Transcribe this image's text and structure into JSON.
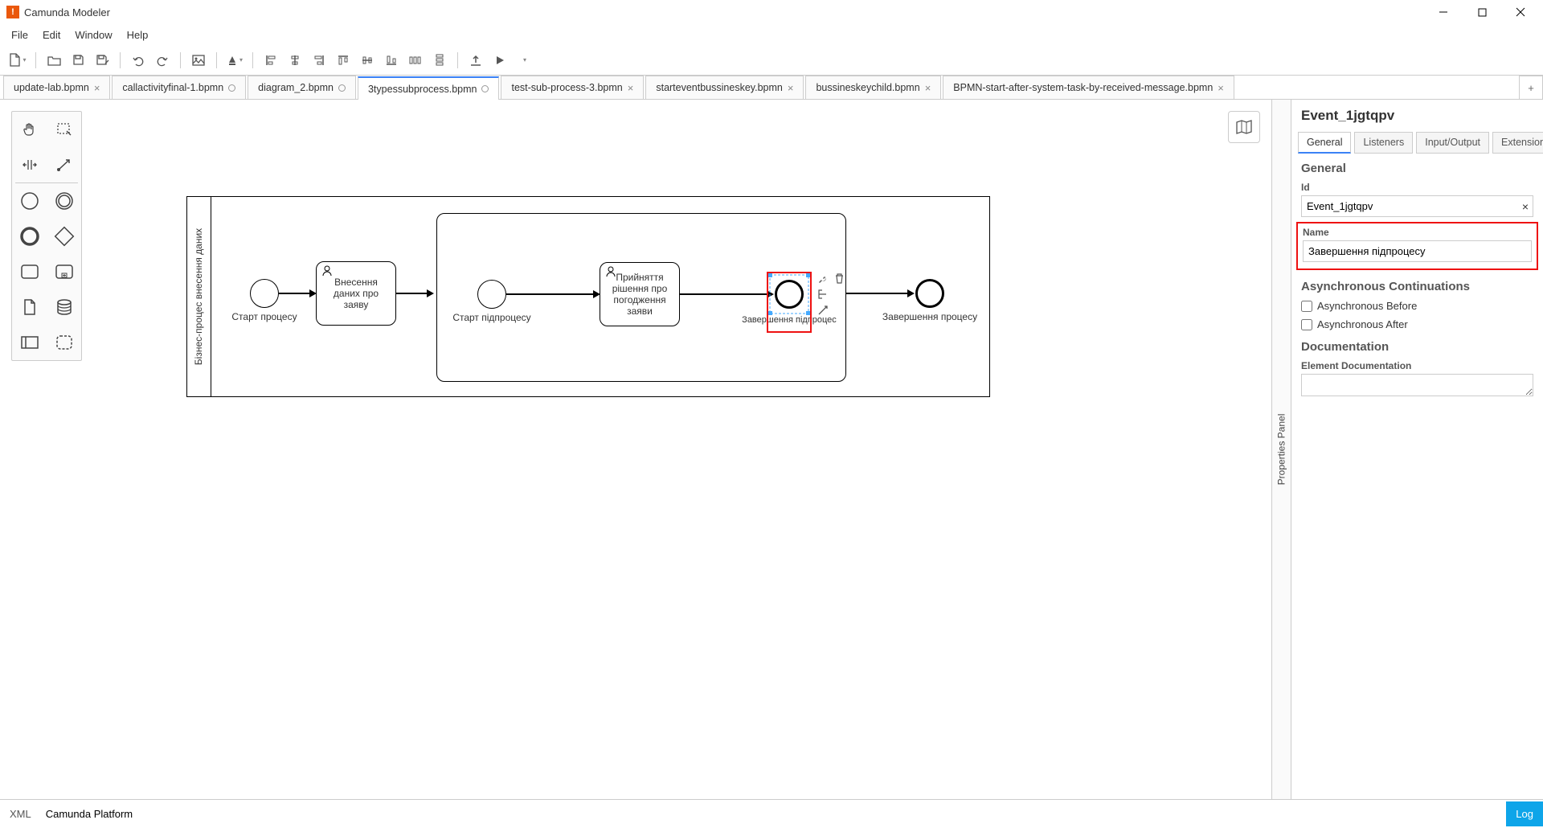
{
  "app_title": "Camunda Modeler",
  "menus": [
    "File",
    "Edit",
    "Window",
    "Help"
  ],
  "tabs": [
    {
      "label": "update-lab.bpmn",
      "icon": "x"
    },
    {
      "label": "callactivityfinal-1.bpmn",
      "icon": "dot"
    },
    {
      "label": "diagram_2.bpmn",
      "icon": "dot"
    },
    {
      "label": "3typessubprocess.bpmn",
      "icon": "dot",
      "active": true
    },
    {
      "label": "test-sub-process-3.bpmn",
      "icon": "x"
    },
    {
      "label": "starteventbussineskey.bpmn",
      "icon": "x"
    },
    {
      "label": "bussineskeychild.bpmn",
      "icon": "x"
    },
    {
      "label": "BPMN-start-after-system-task-by-received-message.bpmn",
      "icon": "x"
    }
  ],
  "diagram": {
    "lane_title": "Бізнес-процес внесення даних",
    "start1": "Старт процесу",
    "task1": "Внесення даних про заяву",
    "start2": "Старт підпроцесу",
    "task2": "Прийняття рішення про погодження заяви",
    "end2": "Завершення підпроцес",
    "end1": "Завершення процесу"
  },
  "props": {
    "title": "Event_1jgtqpv",
    "tabs": [
      "General",
      "Listeners",
      "Input/Output",
      "Extensions"
    ],
    "section_general": "General",
    "id_label": "Id",
    "id_value": "Event_1jgtqpv",
    "name_label": "Name",
    "name_value": "Завершення підпроцесу",
    "async_title": "Asynchronous Continuations",
    "async_before": "Asynchronous Before",
    "async_after": "Asynchronous After",
    "doc_title": "Documentation",
    "doc_label": "Element Documentation",
    "panel_toggle": "Properties Panel"
  },
  "footer": {
    "xml": "XML",
    "platform": "Camunda Platform",
    "log": "Log"
  }
}
